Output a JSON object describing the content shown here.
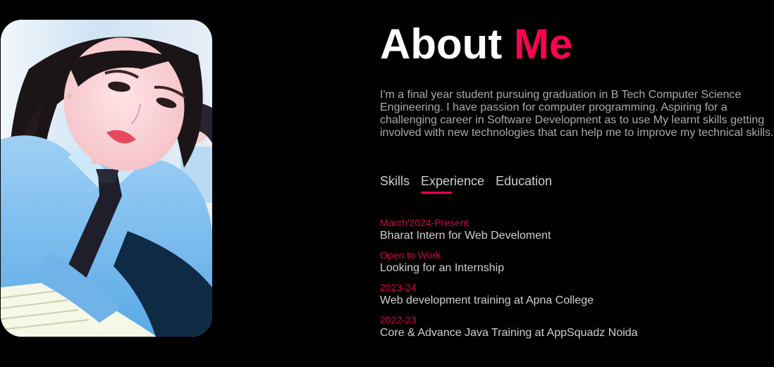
{
  "about": {
    "title_main": "About",
    "title_accent": "Me",
    "bio": "I'm a final year student pursuing graduation in B Tech Computer Science Engineering. I have passion for computer programming. Aspiring for a challenging career in Software Development as to use My learnt skills getting involved with new technologies that can help me to improve my technical skills."
  },
  "tabs": [
    {
      "label": "Skills",
      "active": false
    },
    {
      "label": "Experience",
      "active": true
    },
    {
      "label": "Education",
      "active": false
    }
  ],
  "timeline": [
    {
      "date": "March'2024-Present",
      "text": "Bharat Intern for Web Develoment"
    },
    {
      "date": "Open to Work",
      "text": "Looking for an Internship"
    },
    {
      "date": "2023-24",
      "text": "Web development training at Apna College"
    },
    {
      "date": "2022-23",
      "text": "Core & Advance Java Training at AppSquadz Noida"
    }
  ],
  "colors": {
    "background": "#000000",
    "accent": "#ff004f",
    "text_muted": "#ababab",
    "text_light": "#cfcfcf"
  },
  "icons": {
    "photo": "profile-photo"
  }
}
